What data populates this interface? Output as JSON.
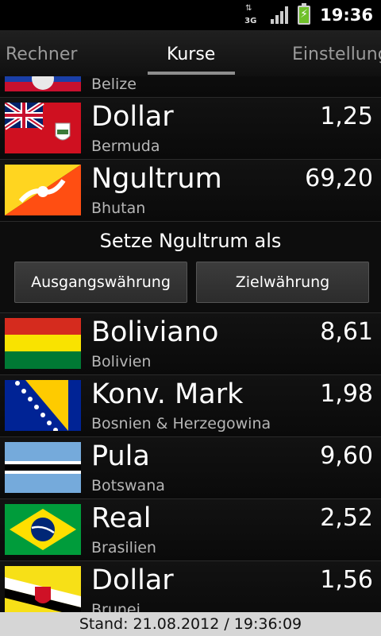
{
  "status": {
    "network": "3G",
    "time": "19:36"
  },
  "tabs": [
    {
      "label": "Rechner"
    },
    {
      "label": "Kurse"
    },
    {
      "label": "Einstellung"
    }
  ],
  "list": {
    "partial_top": {
      "country": "Belize"
    },
    "items": [
      {
        "currency": "Dollar",
        "country": "Bermuda",
        "rate": "1,25"
      },
      {
        "currency": "Ngultrum",
        "country": "Bhutan",
        "rate": "69,20"
      },
      {
        "currency": "Boliviano",
        "country": "Bolivien",
        "rate": "8,61"
      },
      {
        "currency": "Konv. Mark",
        "country": "Bosnien & Herzegowina",
        "rate": "1,98"
      },
      {
        "currency": "Pula",
        "country": "Botswana",
        "rate": "9,60"
      },
      {
        "currency": "Real",
        "country": "Brasilien",
        "rate": "2,52"
      },
      {
        "currency": "Dollar",
        "country": "Brunei",
        "rate": "1,56"
      }
    ],
    "action": {
      "title": "Setze Ngultrum als",
      "source_button": "Ausgangswährung",
      "target_button": "Zielwährung"
    }
  },
  "footer": {
    "text": "Stand: 21.08.2012 / 19:36:09"
  },
  "colors": {
    "background": "#000000",
    "footer_bg": "#d6d6d6",
    "battery": "#6fc02a"
  }
}
